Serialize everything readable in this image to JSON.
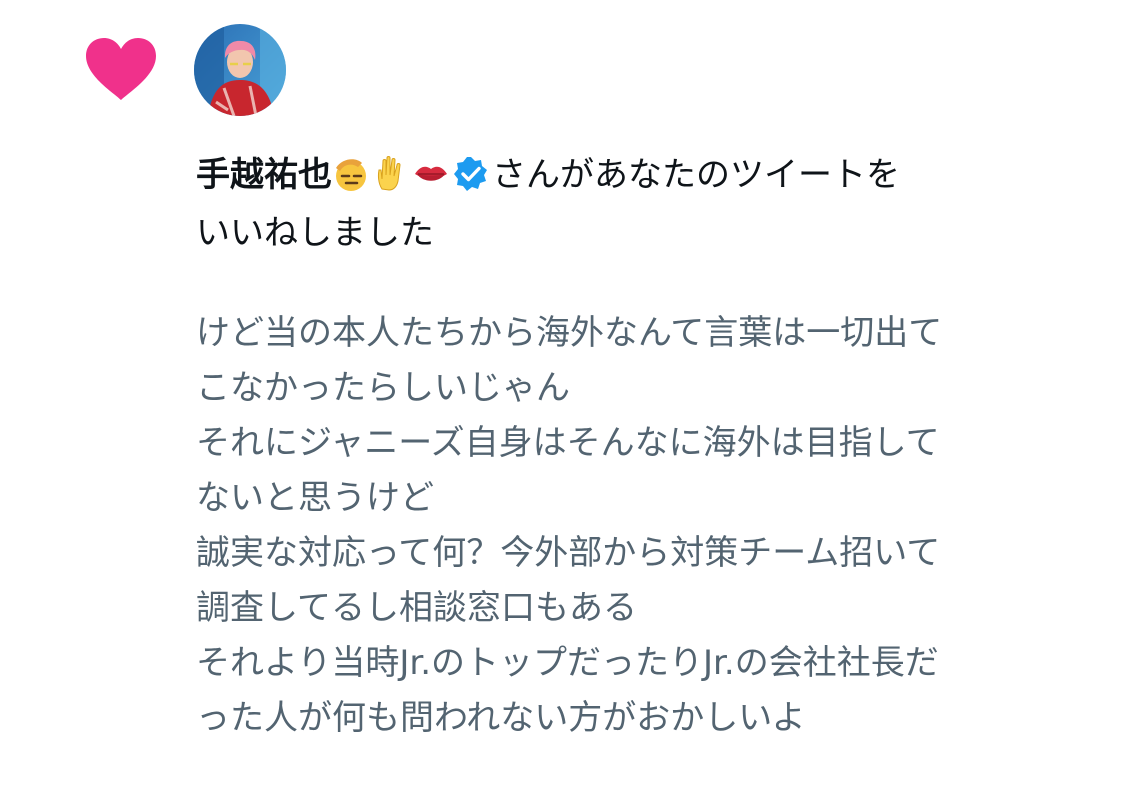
{
  "notification": {
    "type_icon": "heart-icon",
    "type_color": "#f0318b",
    "user": {
      "name": "手越祐也",
      "avatar_icon": "avatar",
      "name_emojis": [
        "saluting-face-icon",
        "raised-hand-icon",
        "kiss-mark-icon"
      ],
      "verified_icon": "verified-badge-icon",
      "verified_color": "#1d9bf0"
    },
    "action_text_line1": "さんがあなたのツイートを",
    "action_text_line2": "いいねしました",
    "tweet_lines": [
      "けど当の本人たちから海外なんて言葉は一切出て",
      "こなかったらしいじゃん",
      "それにジャニーズ自身はそんなに海外は目指して",
      "ないと思うけど",
      "誠実な対応って何？今外部から対策チーム招いて",
      "調査してるし相談窓口もある",
      "それより当時Jr.のトップだったりJr.の会社社長だ",
      "った人が何も問われない方がおかしいよ"
    ]
  }
}
